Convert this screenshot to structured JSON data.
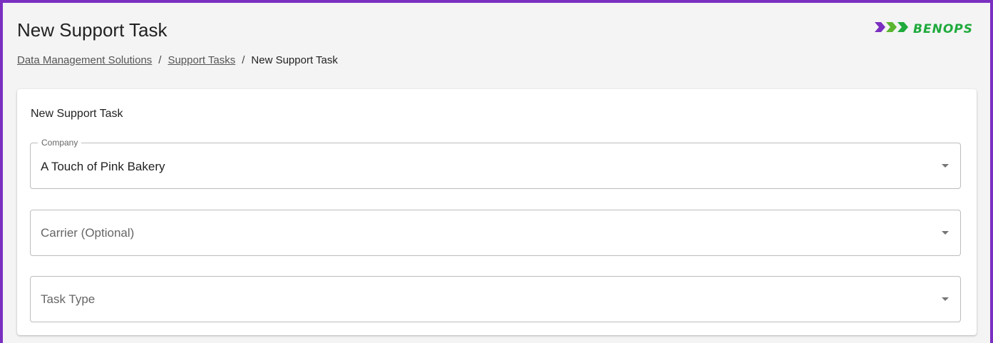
{
  "header": {
    "title": "New Support Task",
    "logo": {
      "text": "BENOPS",
      "icon": "triple-arrow-logo-icon",
      "color": "#1faa3c",
      "arrow_color": "#7a2fc0"
    }
  },
  "breadcrumb": {
    "items": [
      "Data Management Solutions",
      "Support Tasks"
    ],
    "separator": "/",
    "current": "New Support Task"
  },
  "form": {
    "title": "New Support Task",
    "company": {
      "label": "Company",
      "value": "A Touch of Pink Bakery",
      "icon": "dropdown-arrow-icon"
    },
    "carrier": {
      "placeholder": "Carrier (Optional)",
      "icon": "dropdown-arrow-icon"
    },
    "task_type": {
      "placeholder": "Task Type",
      "icon": "dropdown-arrow-icon"
    }
  },
  "colors": {
    "frame_border": "#7a2fc0",
    "background": "#f4f4f4",
    "card": "#ffffff"
  }
}
